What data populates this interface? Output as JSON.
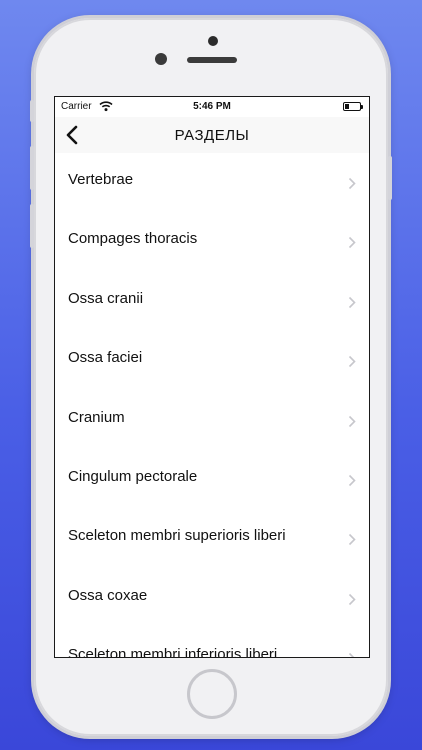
{
  "status_bar": {
    "carrier": "Carrier",
    "time": "5:46 PM"
  },
  "nav": {
    "title": "РАЗДЕЛЫ",
    "back_icon": "chevron-left-icon"
  },
  "list": {
    "items": [
      {
        "label": "Vertebrae"
      },
      {
        "label": "Compages thoracis"
      },
      {
        "label": "Ossa cranii"
      },
      {
        "label": "Ossa faciei"
      },
      {
        "label": "Cranium"
      },
      {
        "label": "Cingulum pectorale"
      },
      {
        "label": "Sceleton membri superioris liberi"
      },
      {
        "label": "Ossa coxae"
      },
      {
        "label": "Sceleton membri inferioris liberi"
      }
    ],
    "chevron_icon": "chevron-right-icon"
  },
  "colors": {
    "background_top": "#6f88ef",
    "background_bottom": "#3a47d9",
    "chevron": "#c7c7cc"
  }
}
